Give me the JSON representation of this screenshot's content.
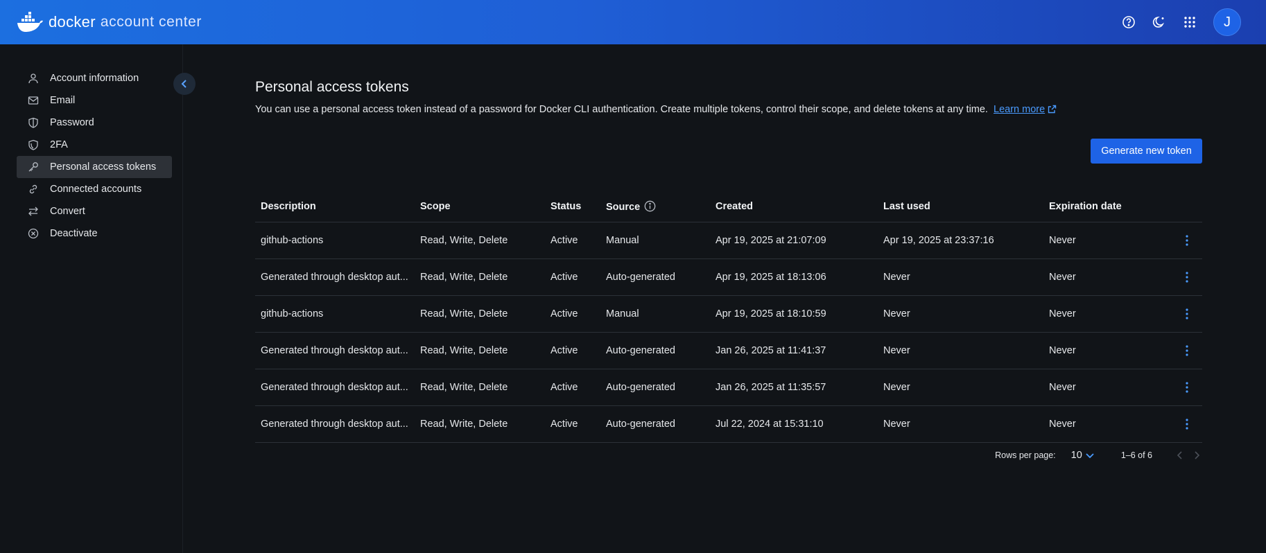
{
  "header": {
    "brand_docker": "docker",
    "brand_sub": "account center",
    "avatar_initial": "J",
    "icons": [
      "help-icon",
      "theme-toggle-icon",
      "apps-grid-icon"
    ]
  },
  "sidebar": {
    "items": [
      {
        "label": "Account information",
        "icon": "user-icon"
      },
      {
        "label": "Email",
        "icon": "mail-icon"
      },
      {
        "label": "Password",
        "icon": "shield-icon"
      },
      {
        "label": "2FA",
        "icon": "shield-check-icon"
      },
      {
        "label": "Personal access tokens",
        "icon": "key-icon",
        "active": true
      },
      {
        "label": "Connected accounts",
        "icon": "link-icon"
      },
      {
        "label": "Convert",
        "icon": "swap-icon"
      },
      {
        "label": "Deactivate",
        "icon": "circle-x-icon"
      }
    ]
  },
  "main": {
    "title": "Personal access tokens",
    "description": "You can use a personal access token instead of a password for Docker CLI authentication. Create multiple tokens, control their scope, and delete tokens at any time.",
    "learn_more": "Learn more",
    "generate_button": "Generate new token"
  },
  "table": {
    "headers": [
      "Description",
      "Scope",
      "Status",
      "Source",
      "Created",
      "Last used",
      "Expiration date"
    ],
    "rows": [
      {
        "description": "github-actions",
        "scope": "Read, Write, Delete",
        "status": "Active",
        "source": "Manual",
        "created": "Apr 19, 2025 at 21:07:09",
        "last_used": "Apr 19, 2025 at 23:37:16",
        "expiration": "Never"
      },
      {
        "description": "Generated through desktop aut...",
        "scope": "Read, Write, Delete",
        "status": "Active",
        "source": "Auto-generated",
        "created": "Apr 19, 2025 at 18:13:06",
        "last_used": "Never",
        "expiration": "Never"
      },
      {
        "description": "github-actions",
        "scope": "Read, Write, Delete",
        "status": "Active",
        "source": "Manual",
        "created": "Apr 19, 2025 at 18:10:59",
        "last_used": "Never",
        "expiration": "Never"
      },
      {
        "description": "Generated through desktop aut...",
        "scope": "Read, Write, Delete",
        "status": "Active",
        "source": "Auto-generated",
        "created": "Jan 26, 2025 at 11:41:37",
        "last_used": "Never",
        "expiration": "Never"
      },
      {
        "description": "Generated through desktop aut...",
        "scope": "Read, Write, Delete",
        "status": "Active",
        "source": "Auto-generated",
        "created": "Jan 26, 2025 at 11:35:57",
        "last_used": "Never",
        "expiration": "Never"
      },
      {
        "description": "Generated through desktop aut...",
        "scope": "Read, Write, Delete",
        "status": "Active",
        "source": "Auto-generated",
        "created": "Jul 22, 2024 at 15:31:10",
        "last_used": "Never",
        "expiration": "Never"
      }
    ]
  },
  "pagination": {
    "rows_per_page_label": "Rows per page:",
    "rows_per_page": "10",
    "range": "1–6 of 6"
  },
  "colors": {
    "accent": "#1e63e6",
    "link": "#4a9bff",
    "background": "#111418"
  }
}
